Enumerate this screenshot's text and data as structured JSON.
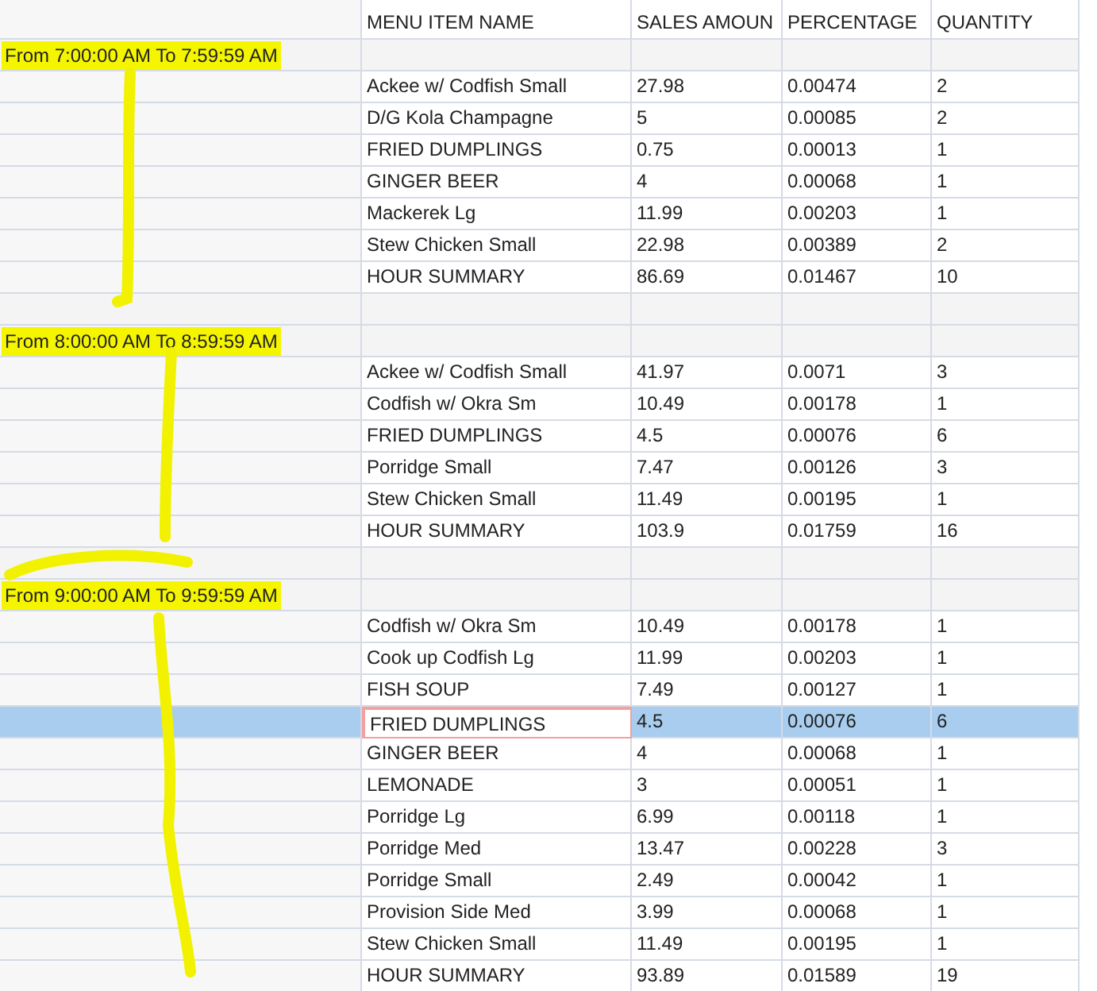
{
  "columns": [
    "MENU ITEM NAME",
    "SALES AMOUN",
    "PERCENTAGE",
    "QUANTITY"
  ],
  "groups": [
    {
      "label": "From 7:00:00 AM To 7:59:59 AM",
      "rows": [
        {
          "item": "Ackee w/ Codfish Small",
          "sales": "27.98",
          "percentage": "0.00474",
          "quantity": "2",
          "selected": false
        },
        {
          "item": "D/G Kola Champagne",
          "sales": "5",
          "percentage": "0.00085",
          "quantity": "2",
          "selected": false
        },
        {
          "item": "FRIED DUMPLINGS",
          "sales": "0.75",
          "percentage": "0.00013",
          "quantity": "1",
          "selected": false
        },
        {
          "item": "GINGER BEER",
          "sales": "4",
          "percentage": "0.00068",
          "quantity": "1",
          "selected": false
        },
        {
          "item": "Mackerek Lg",
          "sales": "11.99",
          "percentage": "0.00203",
          "quantity": "1",
          "selected": false
        },
        {
          "item": "Stew Chicken Small",
          "sales": "22.98",
          "percentage": "0.00389",
          "quantity": "2",
          "selected": false
        },
        {
          "item": "HOUR SUMMARY",
          "sales": "86.69",
          "percentage": "0.01467",
          "quantity": "10",
          "selected": false
        }
      ]
    },
    {
      "label": "From 8:00:00 AM To 8:59:59 AM",
      "rows": [
        {
          "item": "Ackee w/ Codfish Small",
          "sales": "41.97",
          "percentage": "0.0071",
          "quantity": "3",
          "selected": false
        },
        {
          "item": "Codfish w/ Okra Sm",
          "sales": "10.49",
          "percentage": "0.00178",
          "quantity": "1",
          "selected": false
        },
        {
          "item": "FRIED DUMPLINGS",
          "sales": "4.5",
          "percentage": "0.00076",
          "quantity": "6",
          "selected": false
        },
        {
          "item": "Porridge Small",
          "sales": "7.47",
          "percentage": "0.00126",
          "quantity": "3",
          "selected": false
        },
        {
          "item": "Stew Chicken Small",
          "sales": "11.49",
          "percentage": "0.00195",
          "quantity": "1",
          "selected": false
        },
        {
          "item": "HOUR SUMMARY",
          "sales": "103.9",
          "percentage": "0.01759",
          "quantity": "16",
          "selected": false
        }
      ]
    },
    {
      "label": "From 9:00:00 AM To 9:59:59 AM",
      "rows": [
        {
          "item": "Codfish w/ Okra Sm",
          "sales": "10.49",
          "percentage": "0.00178",
          "quantity": "1",
          "selected": false
        },
        {
          "item": "Cook up Codfish Lg",
          "sales": "11.99",
          "percentage": "0.00203",
          "quantity": "1",
          "selected": false
        },
        {
          "item": "FISH SOUP",
          "sales": "7.49",
          "percentage": "0.00127",
          "quantity": "1",
          "selected": false
        },
        {
          "item": "FRIED DUMPLINGS",
          "sales": "4.5",
          "percentage": "0.00076",
          "quantity": "6",
          "selected": true
        },
        {
          "item": "GINGER BEER",
          "sales": "4",
          "percentage": "0.00068",
          "quantity": "1",
          "selected": false
        },
        {
          "item": "LEMONADE",
          "sales": "3",
          "percentage": "0.00051",
          "quantity": "1",
          "selected": false
        },
        {
          "item": "Porridge Lg",
          "sales": "6.99",
          "percentage": "0.00118",
          "quantity": "1",
          "selected": false
        },
        {
          "item": "Porridge Med",
          "sales": "13.47",
          "percentage": "0.00228",
          "quantity": "3",
          "selected": false
        },
        {
          "item": "Porridge Small",
          "sales": "2.49",
          "percentage": "0.00042",
          "quantity": "1",
          "selected": false
        },
        {
          "item": "Provision Side Med",
          "sales": "3.99",
          "percentage": "0.00068",
          "quantity": "1",
          "selected": false
        },
        {
          "item": "Stew Chicken Small",
          "sales": "11.49",
          "percentage": "0.00195",
          "quantity": "1",
          "selected": false
        },
        {
          "item": "HOUR SUMMARY",
          "sales": "93.89",
          "percentage": "0.01589",
          "quantity": "19",
          "selected": false
        }
      ]
    }
  ]
}
